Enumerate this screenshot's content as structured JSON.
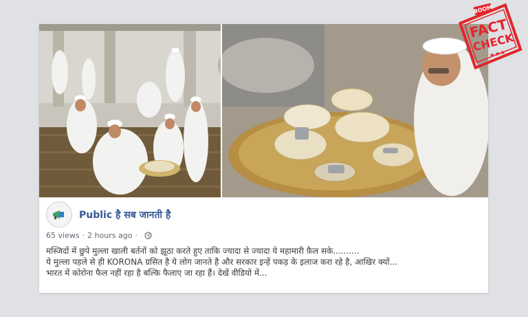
{
  "post": {
    "page_name": "Public है सब जानती है",
    "views": "65 views",
    "separator": "·",
    "time_ago": "2 hours ago",
    "separator2": "·",
    "lines": [
      "मस्जिदों में छुपे मुल्ला खाली बर्तनों को झूठा करते हुए ताकि ज्यादा से ज्यादा ये महामारी फ़ैल सके..........",
      "ये मुल्ला पहले से ही KORONA ग्रसित है ये लोग जानते है और सरकार इन्हें पकड़ के इलाज करा रहे है, आखिर क्यों...",
      "भारत में कोरोना फैल नहीं रहा है बल्कि फैलाए जा रहा हैं। देखें वीडियो में..."
    ]
  },
  "stamp": {
    "brand": "BOOM",
    "line1": "FACT",
    "line2": "CHECK",
    "stars": "★★★",
    "color": "#e2252b"
  },
  "icons": {
    "globe": "globe-icon",
    "avatar": "page-avatar"
  }
}
